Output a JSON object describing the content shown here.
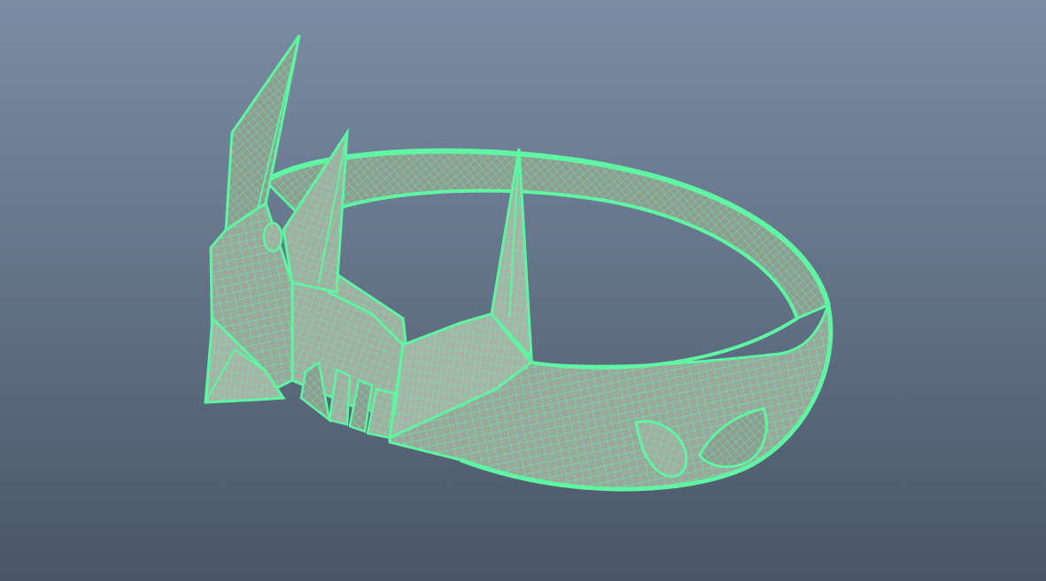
{
  "viewport": {
    "background_top": "#7a8ca3",
    "background_bottom": "#4a5666"
  },
  "model": {
    "wireframe_color": "#5ff5a2",
    "surface_color": "#9aa79c",
    "display_mode": "wireframe-on-shaded",
    "object": "spiked ring"
  }
}
